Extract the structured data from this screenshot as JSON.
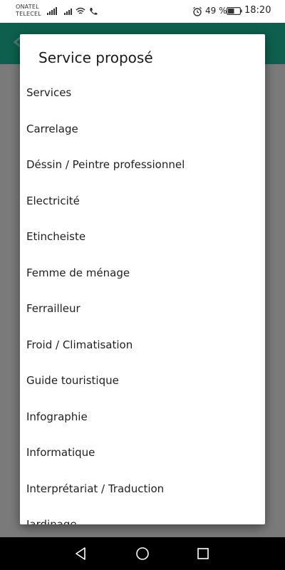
{
  "status_bar": {
    "carrier_line1": "ONATEL",
    "carrier_line2": "TELECEL",
    "battery_percent": "49 %",
    "time": "18:20"
  },
  "dialog": {
    "title": "Service proposé",
    "items": [
      "Services",
      "Carrelage",
      "Déssin / Peintre professionnel",
      "Electricité",
      "Etincheiste",
      "Femme de ménage",
      "Ferrailleur",
      "Froid / Climatisation",
      "Guide touristique",
      "Infographie",
      "Informatique",
      "Interprétariat / Traduction",
      "Jardinage"
    ]
  },
  "colors": {
    "toolbar": "#0e5f4e",
    "scrim": "#6f6f6f",
    "dialog_bg": "#ffffff",
    "nav_bar": "#000000"
  }
}
